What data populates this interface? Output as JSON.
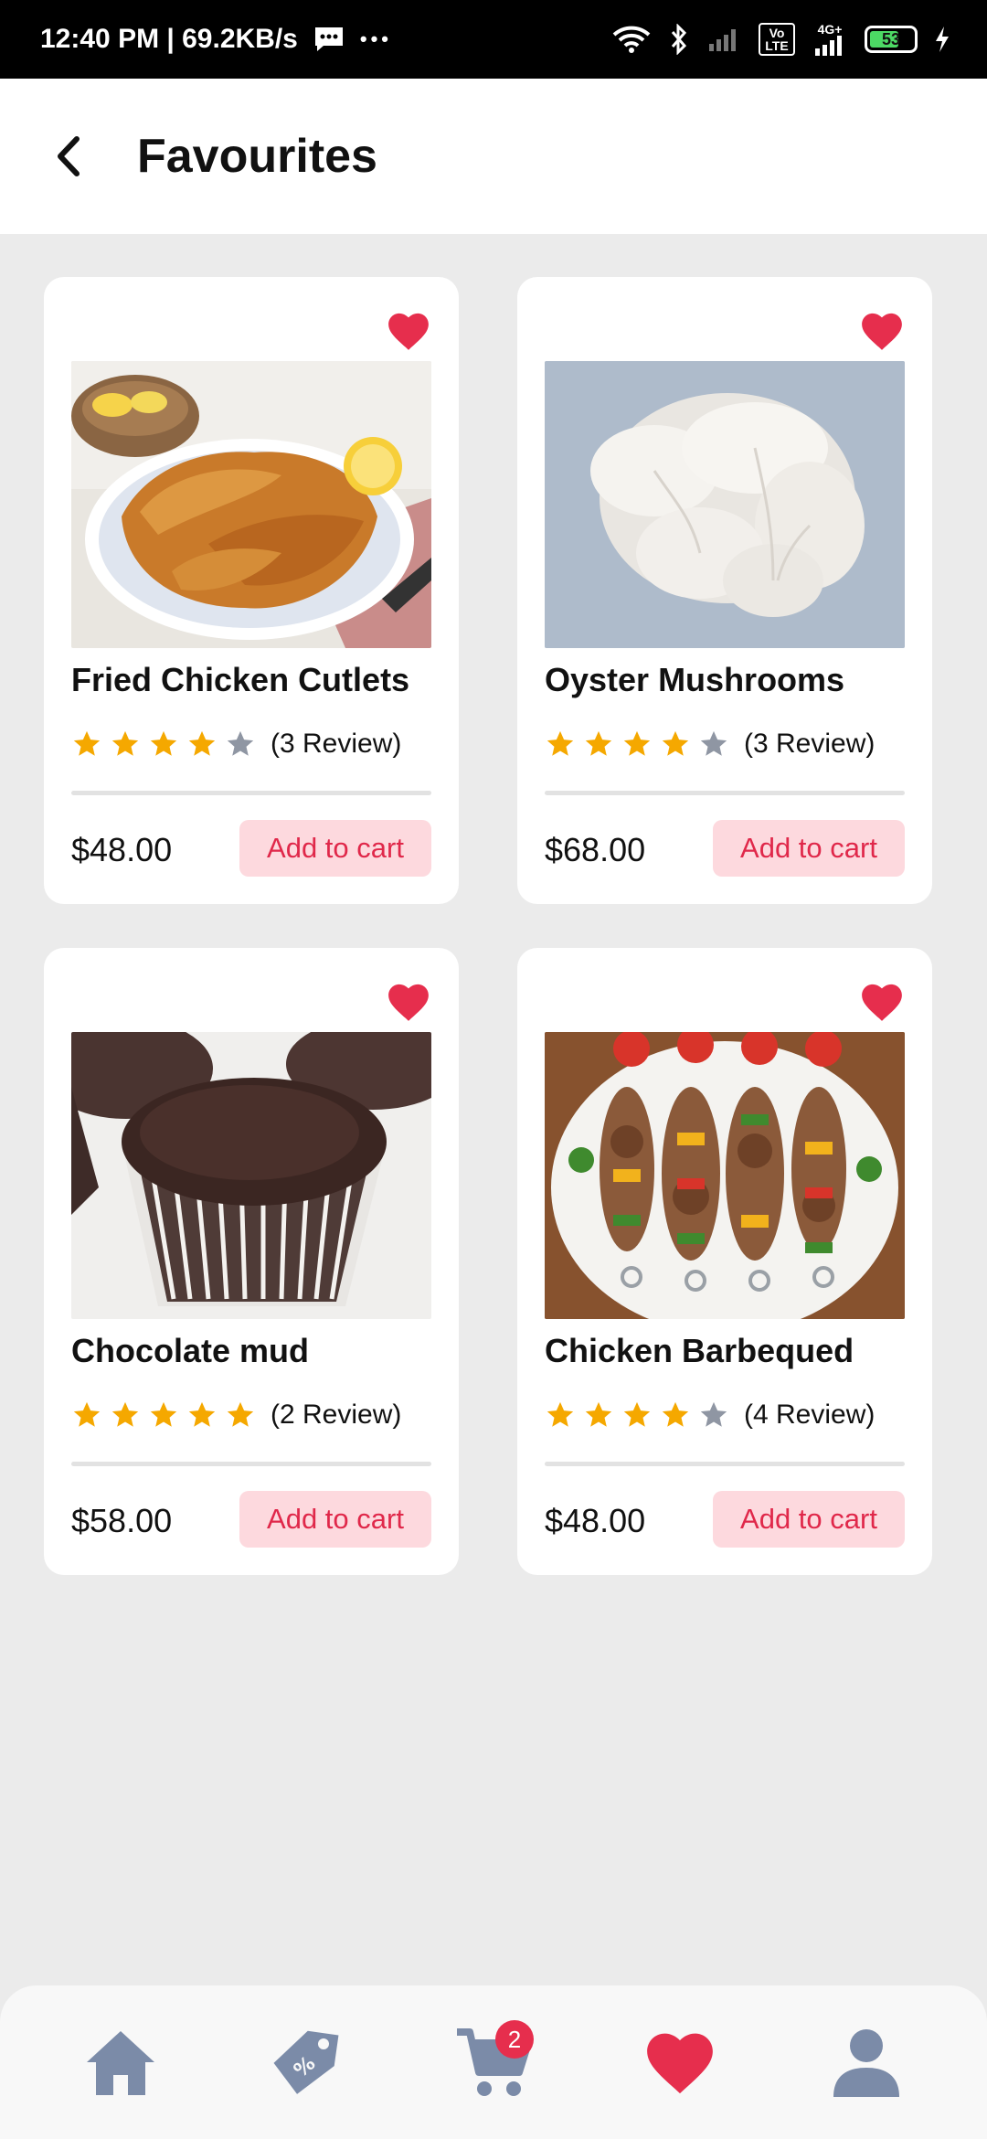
{
  "status_bar": {
    "time_speed": "12:40 PM | 69.2KB/s",
    "more": "•••",
    "volte": "Vo LTE",
    "network": "4G+",
    "battery": "53"
  },
  "header": {
    "title": "Favourites"
  },
  "products": [
    {
      "name": "Fried Chicken Cutlets",
      "rating": 4,
      "reviews": "(3 Review)",
      "price": "$48.00",
      "cart_label": "Add to cart"
    },
    {
      "name": "Oyster Mushrooms",
      "rating": 4,
      "reviews": "(3 Review)",
      "price": "$68.00",
      "cart_label": "Add to cart"
    },
    {
      "name": "Chocolate mud",
      "rating": 5,
      "reviews": "(2 Review)",
      "price": "$58.00",
      "cart_label": "Add to cart"
    },
    {
      "name": "Chicken Barbequed",
      "rating": 4,
      "reviews": "(4 Review)",
      "price": "$48.00",
      "cart_label": "Add to cart"
    }
  ],
  "bottom_nav": {
    "items": [
      "home-icon",
      "offers-tag-icon",
      "cart-icon",
      "heart-icon",
      "profile-icon"
    ],
    "cart_badge": "2",
    "active": "heart-icon"
  },
  "colors": {
    "accent": "#e62e4d",
    "star_filled": "#f5a800",
    "star_empty": "#8f96a3",
    "nav_icon": "#7b8ba8",
    "cart_button_bg": "#fdd9de",
    "cart_button_text": "#e0284a"
  }
}
